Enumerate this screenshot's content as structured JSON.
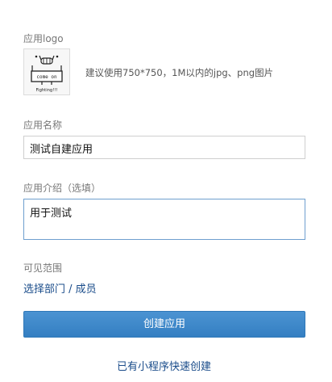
{
  "logo": {
    "label": "应用logo",
    "hint": "建议使用750*750，1M以内的jpg、png图片",
    "image_text_top": "come on",
    "image_text_bottom": "Fighting!!!"
  },
  "name": {
    "label": "应用名称",
    "value": "测试自建应用"
  },
  "intro": {
    "label": "应用介绍（选填）",
    "value": "用于测试"
  },
  "visibility": {
    "label": "可见范围",
    "link": "选择部门 / 成员"
  },
  "submit_label": "创建应用",
  "quick_create_link": "已有小程序快速创建"
}
